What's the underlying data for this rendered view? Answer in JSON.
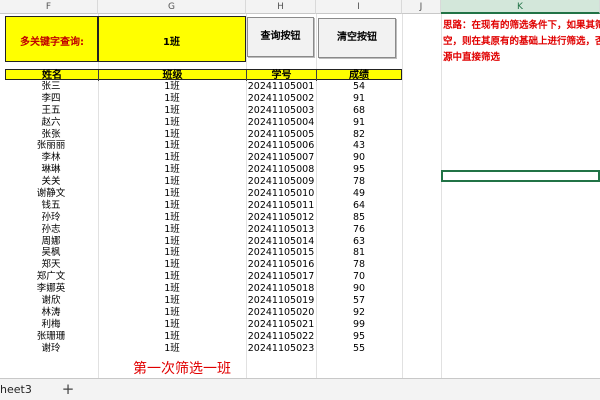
{
  "columns": [
    "F",
    "G",
    "H",
    "I",
    "J",
    "K"
  ],
  "query": {
    "label": "多关键字查询:",
    "value": "1班",
    "search_button": "查询按钮",
    "clear_button": "清空按钮"
  },
  "note": [
    "思路：在现有的筛选条件下，如果其筛",
    "空，则在其原有的基础上进行筛选，否",
    "源中直接筛选"
  ],
  "table": {
    "headers": [
      "姓名",
      "班级",
      "学号",
      "成绩"
    ],
    "rows": [
      [
        "张三",
        "1班",
        "20241105001",
        "54"
      ],
      [
        "李四",
        "1班",
        "20241105002",
        "91"
      ],
      [
        "王五",
        "1班",
        "20241105003",
        "68"
      ],
      [
        "赵六",
        "1班",
        "20241105004",
        "91"
      ],
      [
        "张张",
        "1班",
        "20241105005",
        "82"
      ],
      [
        "张丽丽",
        "1班",
        "20241105006",
        "43"
      ],
      [
        "李林",
        "1班",
        "20241105007",
        "90"
      ],
      [
        "琳琳",
        "1班",
        "20241105008",
        "95"
      ],
      [
        "关关",
        "1班",
        "20241105009",
        "78"
      ],
      [
        "谢静文",
        "1班",
        "20241105010",
        "49"
      ],
      [
        "钱五",
        "1班",
        "20241105011",
        "64"
      ],
      [
        "孙玲",
        "1班",
        "20241105012",
        "85"
      ],
      [
        "孙志",
        "1班",
        "20241105013",
        "76"
      ],
      [
        "周娜",
        "1班",
        "20241105014",
        "63"
      ],
      [
        "吴枫",
        "1班",
        "20241105015",
        "81"
      ],
      [
        "郑天",
        "1班",
        "20241105016",
        "78"
      ],
      [
        "郑广文",
        "1班",
        "20241105017",
        "70"
      ],
      [
        "李娜英",
        "1班",
        "20241105018",
        "90"
      ],
      [
        "谢欣",
        "1班",
        "20241105019",
        "57"
      ],
      [
        "林涛",
        "1班",
        "20241105020",
        "92"
      ],
      [
        "利梅",
        "1班",
        "20241105021",
        "99"
      ],
      [
        "张珊珊",
        "1班",
        "20241105022",
        "95"
      ],
      [
        "谢玲",
        "1班",
        "20241105023",
        "55"
      ]
    ]
  },
  "caption": "第一次筛选一班",
  "sheet_tab": "heet3",
  "add_sheet": "+"
}
